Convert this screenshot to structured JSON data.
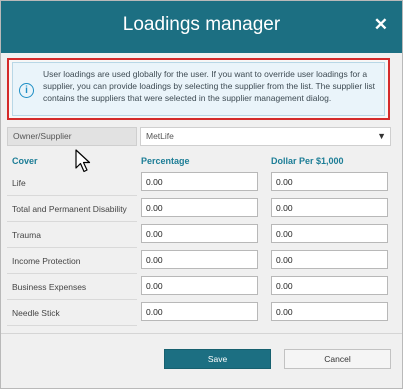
{
  "dialog": {
    "title": "Loadings manager",
    "close_symbol": "✕"
  },
  "info": {
    "icon": "info-icon",
    "text": "User loadings are used globally for the user. If you want to override user loadings for a supplier, you can provide loadings by selecting the supplier from the list. The supplier list contains the suppliers that were selected in the supplier management dialog."
  },
  "owner": {
    "label": "Owner/Supplier",
    "selected": "MetLife"
  },
  "columns": {
    "cover": "Cover",
    "percentage": "Percentage",
    "dollar": "Dollar Per $1,000"
  },
  "rows": [
    {
      "label": "Life",
      "percentage": "0.00",
      "dollar": "0.00"
    },
    {
      "label": "Total and Permanent Disability",
      "percentage": "0.00",
      "dollar": "0.00"
    },
    {
      "label": "Trauma",
      "percentage": "0.00",
      "dollar": "0.00"
    },
    {
      "label": "Income Protection",
      "percentage": "0.00",
      "dollar": "0.00"
    },
    {
      "label": "Business Expenses",
      "percentage": "0.00",
      "dollar": "0.00"
    },
    {
      "label": "Needle Stick",
      "percentage": "0.00",
      "dollar": "0.00"
    }
  ],
  "buttons": {
    "save": "Save",
    "cancel": "Cancel"
  },
  "colors": {
    "titlebar": "#1c6f82",
    "highlight_border": "#d42b2b",
    "accent_text": "#1c7d96"
  }
}
